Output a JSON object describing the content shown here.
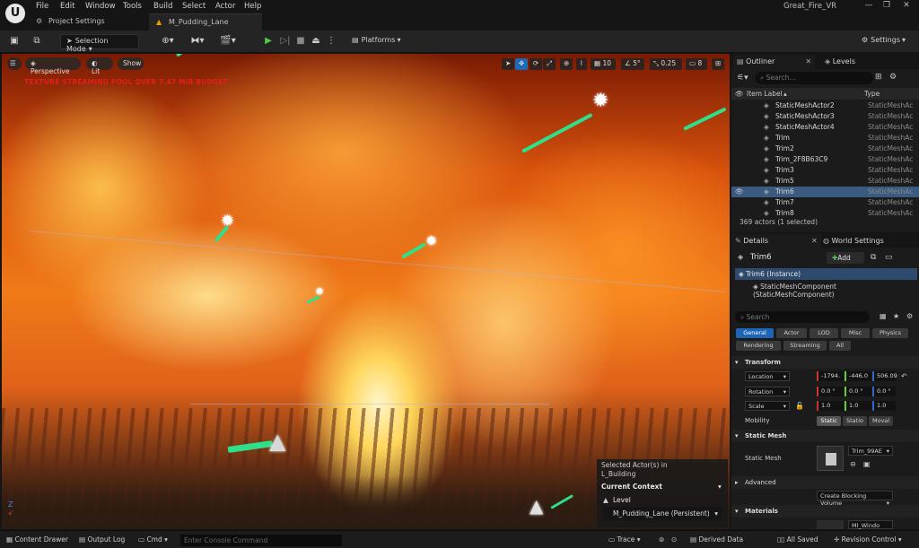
{
  "menubar": {
    "items": [
      "File",
      "Edit",
      "Window",
      "Tools",
      "Build",
      "Select",
      "Actor",
      "Help"
    ],
    "project_name": "Great_Fire_VR"
  },
  "tabs": {
    "project_settings": "Project Settings",
    "level": "M_Pudding_Lane"
  },
  "toolbar": {
    "selection_mode": "Selection Mode",
    "platforms": "Platforms",
    "settings": "Settings"
  },
  "viewport": {
    "perspective": "Perspective",
    "lit": "Lit",
    "show": "Show",
    "warning": "TEXTURE STREAMING POOL OVER 7.47 MiB BUDGET",
    "grid_value": "10",
    "rotation_value": "5°",
    "scale_value": "0.25",
    "camera_speed": "8",
    "selected_actors_label": "Selected Actor(s) in",
    "selected_actors_value": "L_Building",
    "current_context": "Current Context",
    "level_label": "Level",
    "level_value": "M_Pudding_Lane (Persistent)"
  },
  "outliner": {
    "tab_label": "Outliner",
    "levels_tab": "Levels",
    "search_placeholder": "Search...",
    "col_item_label": "Item Label",
    "col_type": "Type",
    "rows": [
      {
        "label": "StaticMeshActor2",
        "type": "StaticMeshAc"
      },
      {
        "label": "StaticMeshActor3",
        "type": "StaticMeshAc"
      },
      {
        "label": "StaticMeshActor4",
        "type": "StaticMeshAc"
      },
      {
        "label": "Trim",
        "type": "StaticMeshAc"
      },
      {
        "label": "Trim2",
        "type": "StaticMeshAc"
      },
      {
        "label": "Trim_2F8B63C9",
        "type": "StaticMeshAc"
      },
      {
        "label": "Trim3",
        "type": "StaticMeshAc"
      },
      {
        "label": "Trim5",
        "type": "StaticMeshAc"
      },
      {
        "label": "Trim6",
        "type": "StaticMeshAc"
      },
      {
        "label": "Trim7",
        "type": "StaticMeshAc"
      },
      {
        "label": "Trim8",
        "type": "StaticMeshAc"
      }
    ],
    "status": "369 actors (1 selected)"
  },
  "details": {
    "tab_label": "Details",
    "world_settings_tab": "World Settings",
    "actor_name": "Trim6",
    "add_label": "Add",
    "instance_label": "Trim6 (Instance)",
    "component_label": "StaticMeshComponent (StaticMeshComponent)",
    "search_placeholder": "Search",
    "categories_row1": [
      "General",
      "Actor",
      "LOD",
      "Misc",
      "Physics"
    ],
    "categories_row2": [
      "Rendering",
      "Streaming",
      "All"
    ],
    "transform_section": "Transform",
    "location_label": "Location",
    "location_values": [
      "-1794.",
      "-446.0",
      "506.09"
    ],
    "rotation_label": "Rotation",
    "rotation_values": [
      "0.0 °",
      "0.0 °",
      "0.0 °"
    ],
    "scale_label": "Scale",
    "scale_values": [
      "1.0",
      "1.0",
      "1.0"
    ],
    "mobility_label": "Mobility",
    "mobility_options": [
      "Static",
      "Statio",
      "Moval"
    ],
    "static_mesh_section": "Static Mesh",
    "static_mesh_label": "Static Mesh",
    "static_mesh_value": "Trim_99AE",
    "advanced_section": "Advanced",
    "create_blocking": "Create Blocking Volume",
    "materials_section": "Materials",
    "material_value": "MI_Windo"
  },
  "statusbar": {
    "content_drawer": "Content Drawer",
    "output_log": "Output Log",
    "cmd": "Cmd",
    "console_placeholder": "Enter Console Command",
    "trace": "Trace",
    "derived_data": "Derived Data",
    "all_saved": "All Saved",
    "revision_control": "Revision Control"
  }
}
